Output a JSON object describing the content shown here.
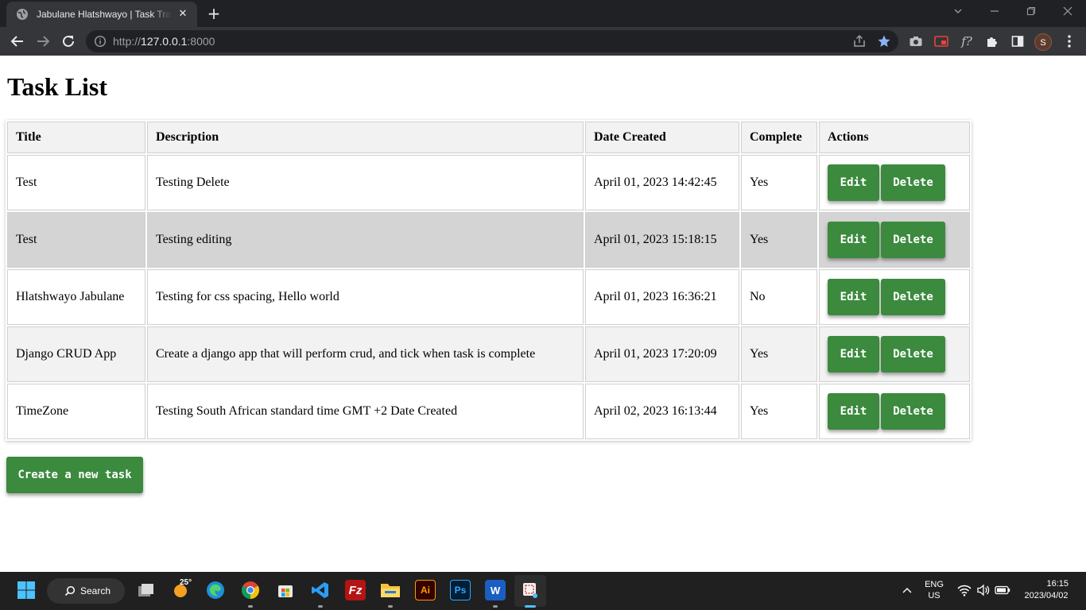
{
  "browser": {
    "tab_title": "Jabulane Hlatshwayo | Task Tracker",
    "tab_close": "✕",
    "new_tab": "+",
    "url_scheme": "http://",
    "url_host": "127.0.0.1",
    "url_port": ":8000",
    "profile_initial": "S"
  },
  "page": {
    "title": "Task List",
    "columns": [
      "Title",
      "Description",
      "Date Created",
      "Complete",
      "Actions"
    ],
    "rows": [
      {
        "title": "Test",
        "description": "Testing Delete",
        "date": "April 01, 2023 14:42:45",
        "complete": "Yes"
      },
      {
        "title": "Test",
        "description": "Testing editing",
        "date": "April 01, 2023 15:18:15",
        "complete": "Yes"
      },
      {
        "title": "Hlatshwayo Jabulane",
        "description": "Testing for css spacing, Hello world",
        "date": "April 01, 2023 16:36:21",
        "complete": "No"
      },
      {
        "title": "Django CRUD App",
        "description": "Create a django app that will perform crud, and tick when task is complete",
        "date": "April 01, 2023 17:20:09",
        "complete": "Yes"
      },
      {
        "title": "TimeZone",
        "description": "Testing South African standard time GMT +2 Date Created",
        "date": "April 02, 2023 16:13:44",
        "complete": "Yes"
      }
    ],
    "edit_label": "Edit",
    "delete_label": "Delete",
    "create_label": "Create a new task",
    "accent_color": "#3b8a3e"
  },
  "taskbar": {
    "search_label": "Search",
    "weather_temp": "25°",
    "lang_line1": "ENG",
    "lang_line2": "US",
    "time": "16:15",
    "date": "2023/04/02"
  }
}
